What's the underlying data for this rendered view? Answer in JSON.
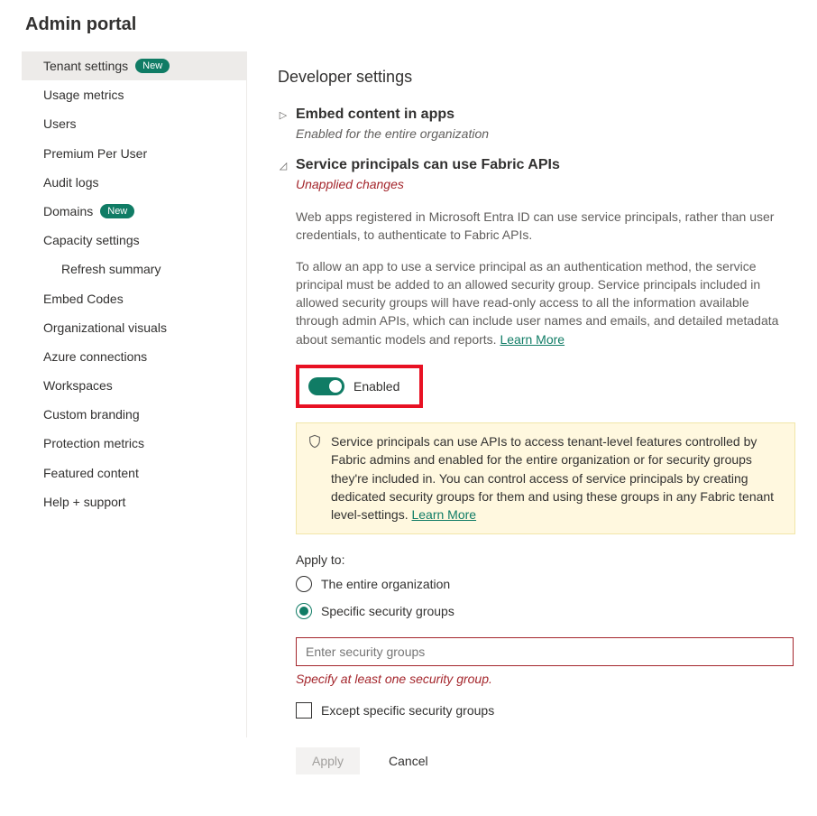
{
  "page_title": "Admin portal",
  "sidebar": {
    "items": [
      {
        "label": "Tenant settings",
        "badge": "New",
        "active": true
      },
      {
        "label": "Usage metrics"
      },
      {
        "label": "Users"
      },
      {
        "label": "Premium Per User"
      },
      {
        "label": "Audit logs"
      },
      {
        "label": "Domains",
        "badge": "New"
      },
      {
        "label": "Capacity settings"
      },
      {
        "label": "Refresh summary",
        "indent": true
      },
      {
        "label": "Embed Codes"
      },
      {
        "label": "Organizational visuals"
      },
      {
        "label": "Azure connections"
      },
      {
        "label": "Workspaces"
      },
      {
        "label": "Custom branding"
      },
      {
        "label": "Protection metrics"
      },
      {
        "label": "Featured content"
      },
      {
        "label": "Help + support"
      }
    ]
  },
  "main": {
    "section_heading": "Developer settings",
    "setting_embed": {
      "title": "Embed content in apps",
      "status": "Enabled for the entire organization"
    },
    "setting_sp": {
      "title": "Service principals can use Fabric APIs",
      "status": "Unapplied changes",
      "desc1": "Web apps registered in Microsoft Entra ID can use service principals, rather than user credentials, to authenticate to Fabric APIs.",
      "desc2_prefix": "To allow an app to use a service principal as an authentication method, the service principal must be added to an allowed security group. Service principals included in allowed security groups will have read-only access to all the information available through admin APIs, which can include user names and emails, and detailed metadata about semantic models and reports.  ",
      "learn_more": "Learn More",
      "toggle_label": "Enabled",
      "infobox_text": "Service principals can use APIs to access tenant-level features controlled by Fabric admins and enabled for the entire organization or for security groups they're included in. You can control access of service principals by creating dedicated security groups for them and using these groups in any Fabric tenant level-settings.  ",
      "infobox_link": "Learn More",
      "apply_to_label": "Apply to:",
      "radio_entire": "The entire organization",
      "radio_specific": "Specific security groups",
      "input_placeholder": "Enter security groups",
      "input_error": "Specify at least one security group.",
      "except_label": "Except specific security groups",
      "btn_apply": "Apply",
      "btn_cancel": "Cancel"
    }
  },
  "colors": {
    "brand": "#107c65",
    "danger": "#a4262c",
    "callout_border": "#e81123",
    "info_bg": "#fff8df"
  }
}
